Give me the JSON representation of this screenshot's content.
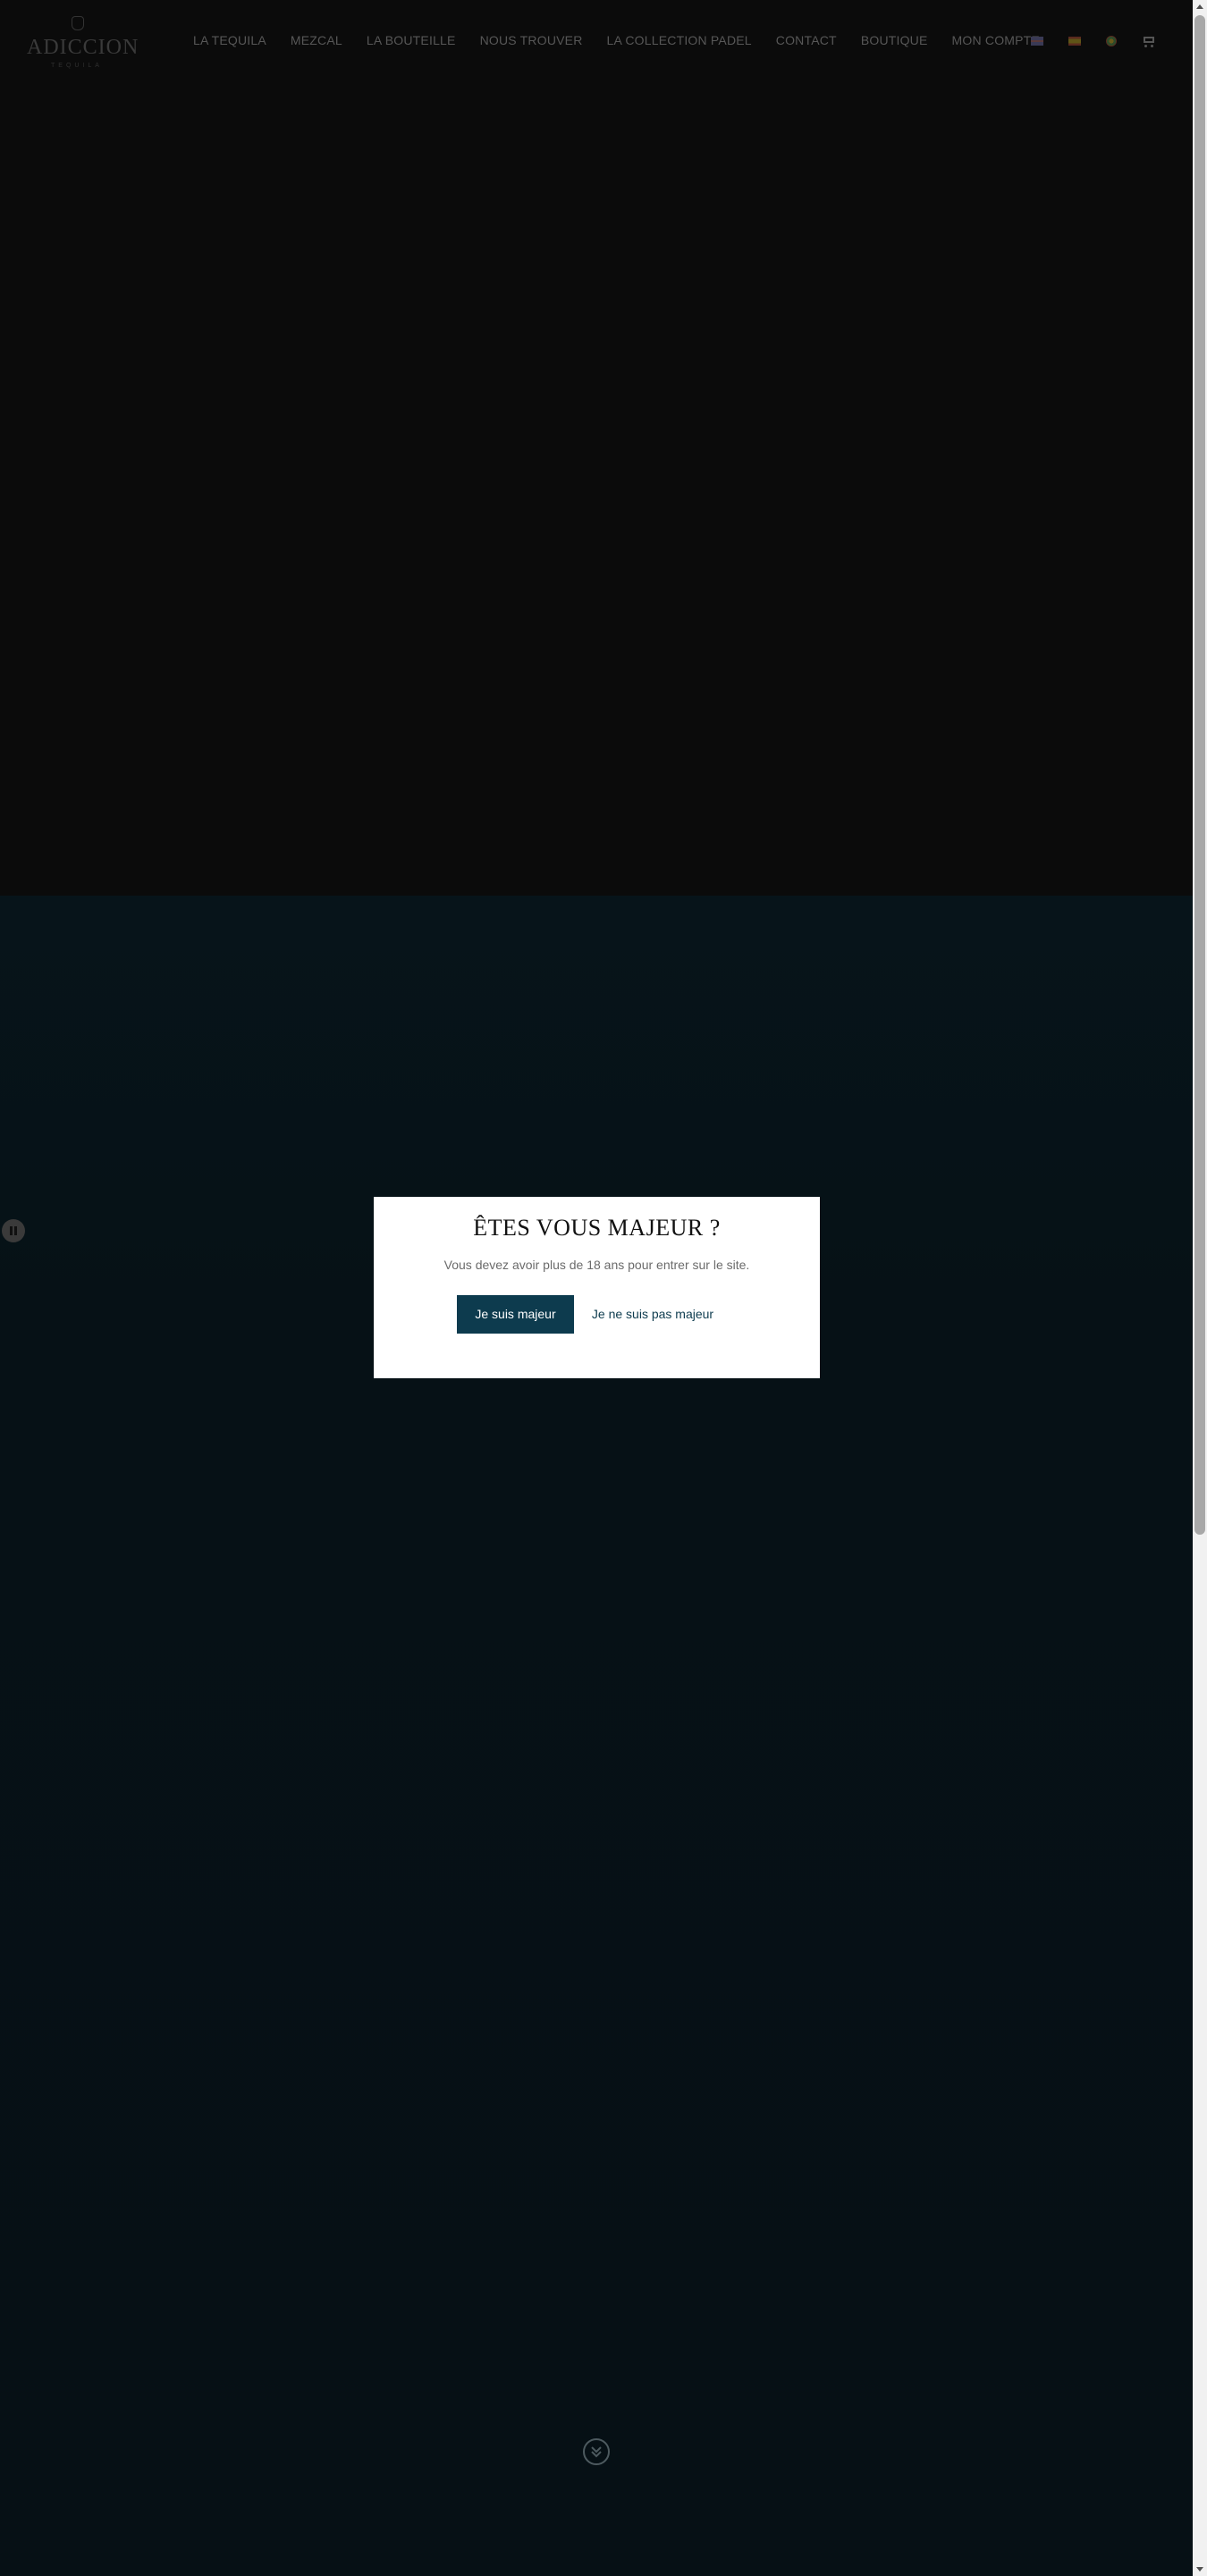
{
  "header": {
    "logo_text": "ADICCION",
    "logo_sub": "TEQUILA",
    "nav": [
      {
        "label": "LA TEQUILA"
      },
      {
        "label": "MEZCAL"
      },
      {
        "label": "LA BOUTEILLE"
      },
      {
        "label": "NOUS TROUVER"
      },
      {
        "label": "LA COLLECTION PADEL"
      },
      {
        "label": "CONTACT"
      },
      {
        "label": "BOUTIQUE"
      },
      {
        "label": "MON COMPTE"
      }
    ],
    "icons": [
      "flag-en-icon",
      "flag-es-icon",
      "flag-pt-icon",
      "cart-icon"
    ]
  },
  "age_gate": {
    "title": "ÊTES VOUS MAJEUR ?",
    "message": "Vous devez avoir plus de 18 ans pour entrer sur le site.",
    "confirm_label": "Je suis majeur",
    "deny_label": "Je ne suis pas majeur"
  },
  "video": {
    "pause_icon": "pause-icon"
  },
  "scroll": {
    "icon": "chevron-double-down-icon"
  },
  "colors": {
    "primary": "#0d3b4e",
    "hero_bg": "#0b0b0b",
    "section_bg": "#061116"
  }
}
